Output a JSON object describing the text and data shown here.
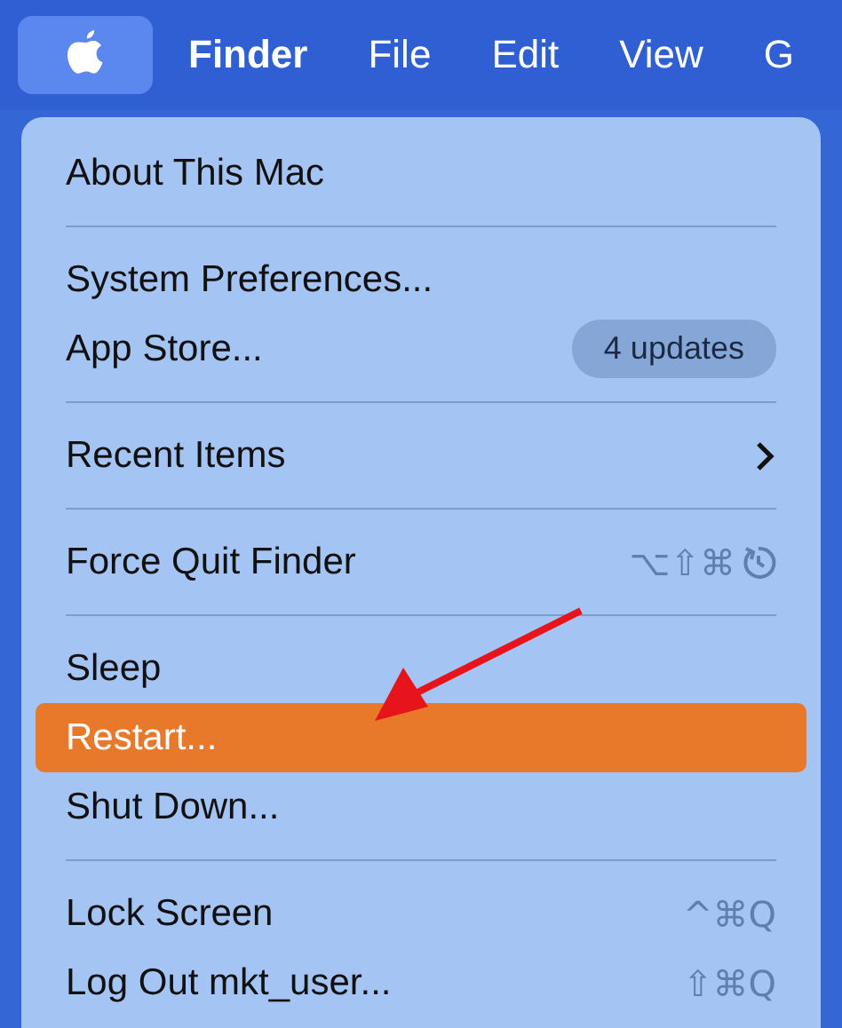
{
  "menu_bar": [
    {
      "kind": "apple",
      "selected": true
    },
    {
      "kind": "text",
      "label": "Finder",
      "selected": false,
      "bold": true
    },
    {
      "kind": "text",
      "label": "File",
      "selected": false,
      "bold": false
    },
    {
      "kind": "text",
      "label": "Edit",
      "selected": false,
      "bold": false
    },
    {
      "kind": "text",
      "label": "View",
      "selected": false,
      "bold": false
    },
    {
      "kind": "text",
      "label": "G",
      "selected": false,
      "bold": false
    }
  ],
  "menu": [
    {
      "kind": "item",
      "label": "About This Mac",
      "selected": false
    },
    {
      "kind": "separator"
    },
    {
      "kind": "item",
      "label": "System Preferences...",
      "selected": false
    },
    {
      "kind": "item",
      "label": "App Store...",
      "selected": false,
      "badge": "4 updates"
    },
    {
      "kind": "separator"
    },
    {
      "kind": "item",
      "label": "Recent Items",
      "selected": false,
      "submenu": true
    },
    {
      "kind": "separator"
    },
    {
      "kind": "item",
      "label": "Force Quit Finder",
      "selected": false,
      "shortcut": "⌥⇧⌘",
      "restart_icon": true
    },
    {
      "kind": "separator"
    },
    {
      "kind": "item",
      "label": "Sleep",
      "selected": false
    },
    {
      "kind": "item",
      "label": "Restart...",
      "selected": true
    },
    {
      "kind": "item",
      "label": "Shut Down...",
      "selected": false
    },
    {
      "kind": "separator"
    },
    {
      "kind": "item",
      "label": "Lock Screen",
      "selected": false,
      "shortcut": "^⌘Q"
    },
    {
      "kind": "item",
      "label": "Log Out mkt_user...",
      "selected": false,
      "shortcut": "⇧⌘Q"
    }
  ],
  "annotation": {
    "kind": "arrow"
  }
}
